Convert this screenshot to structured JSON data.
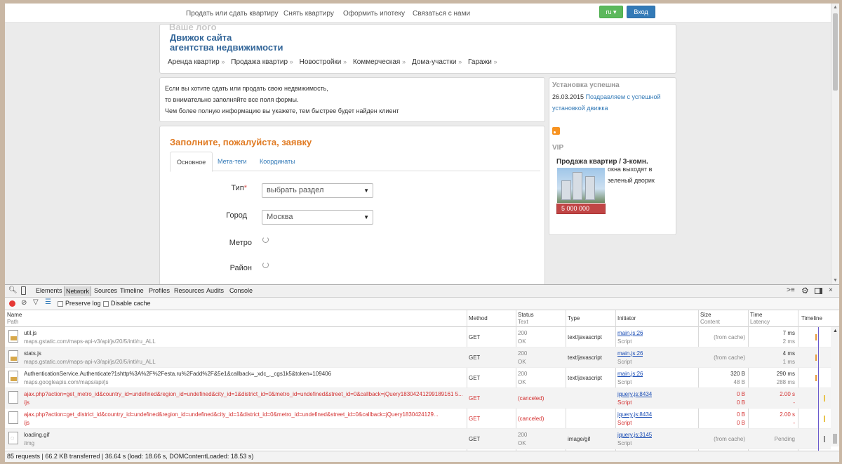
{
  "site": {
    "topnav": [
      "Продать или сдать квартиру",
      "Снять квартиру",
      "Оформить ипотеку",
      "Связаться с нами"
    ],
    "lang_label": "ru",
    "login_label": "Вход",
    "logo_faded": "Ваше лого",
    "logo_line1": "Движок сайта",
    "logo_line2": "агентства недвижимости",
    "categories": [
      "Аренда квартир",
      "Продажа квартир",
      "Новостройки",
      "Коммерческая",
      "Дома-участки",
      "Гаражи"
    ],
    "cat_sep": "»",
    "info": [
      "Если вы хотите сдать или продать свою недвижимость,",
      "то внимательно заполняйте все поля формы.",
      "Чем более полную информацию вы укажете, тем быстрее будет найден клиент"
    ],
    "form": {
      "title": "Заполните, пожалуйста, заявку",
      "tabs": [
        "Основное",
        "Мета-теги",
        "Координаты"
      ],
      "type_label": "Тип",
      "required_mark": "*",
      "type_value": "выбрать раздел",
      "city_label": "Город",
      "city_value": "Москва",
      "metro_label": "Метро",
      "district_label": "Район",
      "caret": "▼"
    },
    "sidebar": {
      "install_head": "Установка успешна",
      "install_date": "26.03.2015",
      "install_link_1": "Поздравляем с успешной",
      "install_link_2": "установкой движка",
      "vip_head": "VIP",
      "vip_title": "Продажа квартир / 3-комн.",
      "vip_desc_1": "окна выходят в",
      "vip_desc_2": "зеленый дворик",
      "vip_price": "5 000 000"
    }
  },
  "devtools": {
    "tabs": [
      "Elements",
      "Network",
      "Sources",
      "Timeline",
      "Profiles",
      "Resources",
      "Audits",
      "Console"
    ],
    "preserve_log": "Preserve log",
    "disable_cache": "Disable cache",
    "headers": {
      "name": "Name",
      "path": "Path",
      "method": "Method",
      "status": "Status",
      "text": "Text",
      "type": "Type",
      "initiator": "Initiator",
      "size": "Size",
      "content": "Content",
      "time": "Time",
      "latency": "Latency",
      "timeline": "Timeline"
    },
    "rows": [
      {
        "name": "util.js",
        "path": "maps.gstatic.com/maps-api-v3/api/js/20/5/intl/ru_ALL",
        "method": "GET",
        "status": "200",
        "text": "OK",
        "type": "text/javascript",
        "initiator": "main.js:26",
        "init_type": "Script",
        "size": "(from cache)",
        "content": "",
        "time": "7 ms",
        "latency": "2 ms"
      },
      {
        "name": "stats.js",
        "path": "maps.gstatic.com/maps-api-v3/api/js/20/5/intl/ru_ALL",
        "method": "GET",
        "status": "200",
        "text": "OK",
        "type": "text/javascript",
        "initiator": "main.js:26",
        "init_type": "Script",
        "size": "(from cache)",
        "content": "",
        "time": "4 ms",
        "latency": "1 ms"
      },
      {
        "name": "AuthenticationService.Authenticate?1shttp%3A%2F%2Festa.ru%2Fadd%2F&5e1&callback=_xdc_._cgs1k5&token=109406",
        "path": "maps.googleapis.com/maps/api/js",
        "method": "GET",
        "status": "200",
        "text": "OK",
        "type": "text/javascript",
        "initiator": "main.js:26",
        "init_type": "Script",
        "size": "320 B",
        "content": "48 B",
        "time": "290 ms",
        "latency": "288 ms"
      },
      {
        "name": "ajax.php?action=get_metro_id&country_id=undefined&region_id=undefined&city_id=1&district_id=0&metro_id=undefined&street_id=0&callback=jQuery18304241299189161 5...",
        "path": "/js",
        "method": "GET",
        "status": "(canceled)",
        "text": "",
        "type": "",
        "initiator": "jquery.js:8434",
        "init_type": "Script",
        "size": "0 B",
        "content": "0 B",
        "time": "2.00 s",
        "latency": "-"
      },
      {
        "name": "ajax.php?action=get_district_id&country_id=undefined&region_id=undefined&city_id=1&district_id=0&metro_id=undefined&street_id=0&callback=jQuery1830424129...",
        "path": "/js",
        "method": "GET",
        "status": "(canceled)",
        "text": "",
        "type": "",
        "initiator": "jquery.js:8434",
        "init_type": "Script",
        "size": "0 B",
        "content": "0 B",
        "time": "2.00 s",
        "latency": "-"
      },
      {
        "name": "loading.gif",
        "path": "/img",
        "method": "GET",
        "status": "200",
        "text": "OK",
        "type": "image/gif",
        "initiator": "jquery.js:3145",
        "init_type": "Script",
        "size": "(from cache)",
        "content": "",
        "time": "Pending",
        "latency": ""
      }
    ],
    "status_bar": "85 requests | 66.2 KB transferred | 36.64 s (load: 18.66 s, DOMContentLoaded: 18.53 s)"
  }
}
